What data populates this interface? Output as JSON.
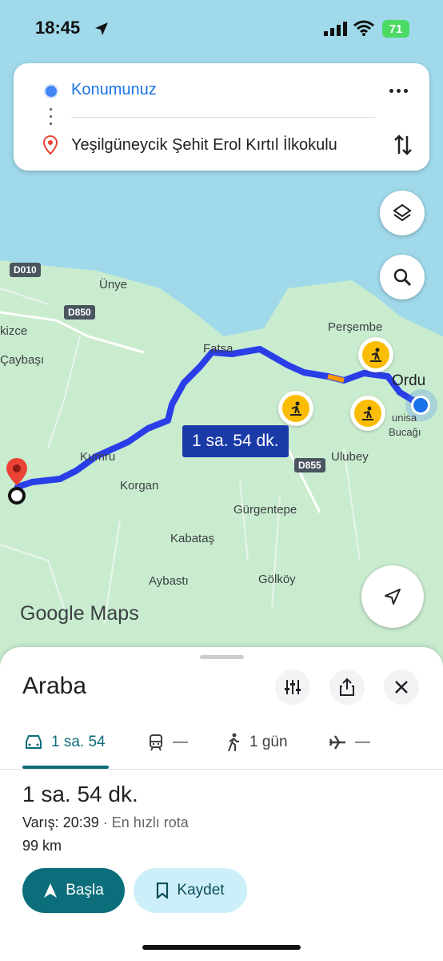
{
  "status_bar": {
    "time": "18:45",
    "battery": "71"
  },
  "route_card": {
    "origin": "Konumunuz",
    "destination": "Yeşilgüneycik Şehit Erol Kırtıl İlkokulu"
  },
  "map": {
    "labels": {
      "unye": "Ünye",
      "kizce": "kizce",
      "caybasi": "Çaybaşı",
      "fatsa": "Fatsa",
      "persembe": "Perşembe",
      "ordu": "Ordu",
      "kumru": "Kumru",
      "korgan": "Korgan",
      "ulubey": "Ulubey",
      "gurgentepe": "Gürgentepe",
      "kabatas": "Kabataş",
      "aybasti": "Aybastı",
      "golkoy": "Gölköy",
      "unisa": "unisa",
      "bucagi": "Bucağı"
    },
    "roads": {
      "d010": "D010",
      "d850": "D850",
      "d855": "D855"
    },
    "eta": "1 sa. 54 dk.",
    "logo": "Google Maps"
  },
  "sheet": {
    "title": "Araba",
    "tabs": {
      "car": "1 sa. 54",
      "transit": "—",
      "walk": "1 gün",
      "flight": "—"
    },
    "duration": "1 sa. 54 dk.",
    "arrival": "Varış: 20:39",
    "fastest": "· En hızlı rota",
    "distance": "99 km",
    "start": "Başla",
    "save": "Kaydet"
  },
  "colors": {
    "accent": "#0b6e7a",
    "route": "#2a3ee8",
    "land": "#c9eccf",
    "water": "#9fd9ea"
  }
}
